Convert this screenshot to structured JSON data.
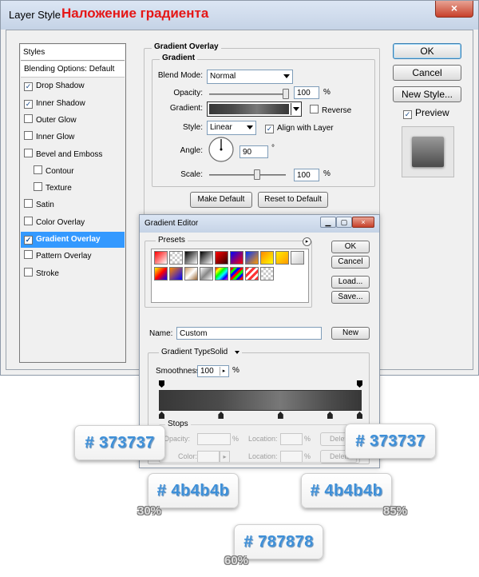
{
  "window": {
    "title": "Layer Style",
    "title_ru": "Наложение градиента",
    "close_icon": "×"
  },
  "styles_list": {
    "header": "Styles",
    "items": [
      {
        "label": "Blending Options: Default",
        "checkbox": false,
        "checked": false,
        "selected": false,
        "indent": 0
      },
      {
        "label": "Drop Shadow",
        "checkbox": true,
        "checked": true,
        "selected": false,
        "indent": 0
      },
      {
        "label": "Inner Shadow",
        "checkbox": true,
        "checked": true,
        "selected": false,
        "indent": 0
      },
      {
        "label": "Outer Glow",
        "checkbox": true,
        "checked": false,
        "selected": false,
        "indent": 0
      },
      {
        "label": "Inner Glow",
        "checkbox": true,
        "checked": false,
        "selected": false,
        "indent": 0
      },
      {
        "label": "Bevel and Emboss",
        "checkbox": true,
        "checked": false,
        "selected": false,
        "indent": 0
      },
      {
        "label": "Contour",
        "checkbox": true,
        "checked": false,
        "selected": false,
        "indent": 1
      },
      {
        "label": "Texture",
        "checkbox": true,
        "checked": false,
        "selected": false,
        "indent": 1
      },
      {
        "label": "Satin",
        "checkbox": true,
        "checked": false,
        "selected": false,
        "indent": 0
      },
      {
        "label": "Color Overlay",
        "checkbox": true,
        "checked": false,
        "selected": false,
        "indent": 0
      },
      {
        "label": "Gradient Overlay",
        "checkbox": true,
        "checked": true,
        "selected": true,
        "indent": 0
      },
      {
        "label": "Pattern Overlay",
        "checkbox": true,
        "checked": false,
        "selected": false,
        "indent": 0
      },
      {
        "label": "Stroke",
        "checkbox": true,
        "checked": false,
        "selected": false,
        "indent": 0
      }
    ]
  },
  "gradient_overlay": {
    "group_title": "Gradient Overlay",
    "sub_title": "Gradient",
    "blend_mode_label": "Blend Mode:",
    "blend_mode": "Normal",
    "opacity_label": "Opacity:",
    "opacity": "100",
    "opacity_unit": "%",
    "gradient_label": "Gradient:",
    "reverse_label": "Reverse",
    "style_label": "Style:",
    "style": "Linear",
    "align_label": "Align with Layer",
    "angle_label": "Angle:",
    "angle": "90",
    "angle_unit": "°",
    "scale_label": "Scale:",
    "scale": "100",
    "scale_unit": "%",
    "make_default": "Make Default",
    "reset_default": "Reset to Default"
  },
  "side_buttons": {
    "ok": "OK",
    "cancel": "Cancel",
    "new_style": "New Style...",
    "preview": "Preview"
  },
  "gradient_editor": {
    "title": "Gradient Editor",
    "presets_label": "Presets",
    "ok": "OK",
    "cancel": "Cancel",
    "load": "Load...",
    "save": "Save...",
    "name_label": "Name:",
    "name_value": "Custom",
    "new_button": "New",
    "type_label": "Gradient Type:",
    "type_value": "Solid",
    "smoothness_label": "Smoothness:",
    "smoothness": "100",
    "smoothness_unit": "%",
    "stops_label": "Stops",
    "opacity_label": "Opacity:",
    "location_label": "Location:",
    "percent": "%",
    "color_label": "Color:",
    "delete_label": "Delete"
  },
  "callouts": [
    {
      "hex": "# 373737"
    },
    {
      "hex": "# 373737"
    },
    {
      "hex": "# 4b4b4b",
      "pct": "30%"
    },
    {
      "hex": "# 4b4b4b",
      "pct": "85%"
    },
    {
      "hex": "# 787878",
      "pct": "60%"
    }
  ],
  "colors": {
    "accent": "#3399ff",
    "title_red": "#e51616",
    "callout_text": "#3d8fd8",
    "grad_dark": "#373737",
    "grad_mid": "#4b4b4b",
    "grad_light": "#787878"
  }
}
